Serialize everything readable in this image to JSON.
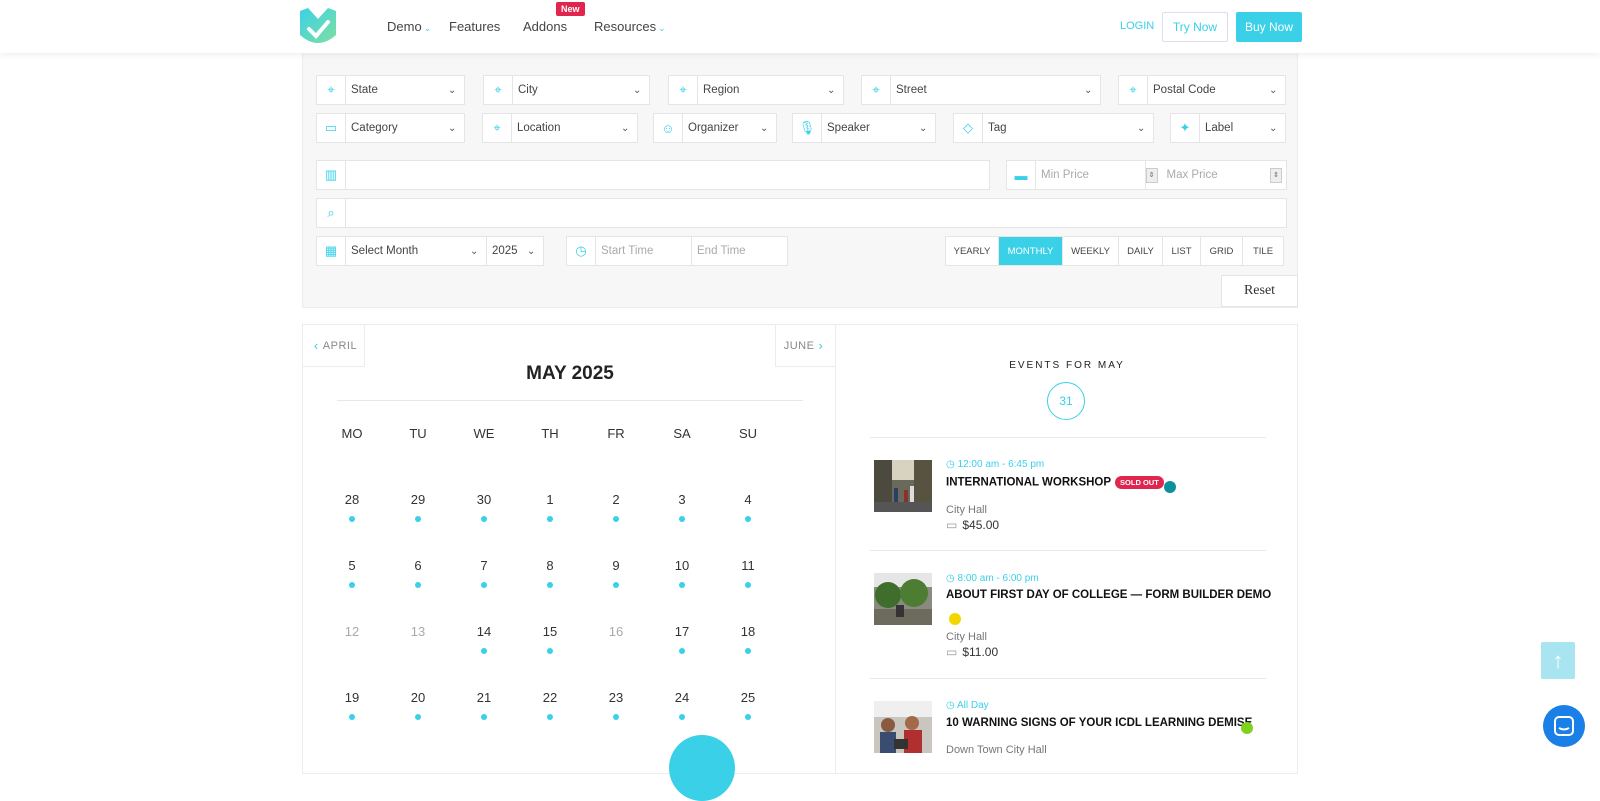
{
  "nav": {
    "logo": "mec-logo",
    "links": [
      {
        "label": "Demo",
        "dropdown": true
      },
      {
        "label": "Features",
        "dropdown": false
      },
      {
        "label": "Addons",
        "dropdown": false
      },
      {
        "label": "Resources",
        "dropdown": true
      }
    ],
    "new_badge": "New",
    "login": "LOGIN",
    "try_now": "Try Now",
    "buy_now": "Buy Now"
  },
  "filters": {
    "state": "State",
    "city": "City",
    "region": "Region",
    "street": "Street",
    "postal_code": "Postal Code",
    "category": "Category",
    "location": "Location",
    "organizer": "Organizer",
    "speaker": "Speaker",
    "tag": "Tag",
    "label": "Label",
    "address_value": "",
    "min_price_placeholder": "Min Price",
    "max_price_placeholder": "Max Price",
    "search_value": "",
    "month": "Select Month",
    "year": "2025",
    "start_time_placeholder": "Start Time",
    "end_time_placeholder": "End Time",
    "views": [
      "YEARLY",
      "MONTHLY",
      "WEEKLY",
      "DAILY",
      "LIST",
      "GRID",
      "TILE"
    ],
    "active_view": "MONTHLY",
    "reset": "Reset"
  },
  "calendar": {
    "prev": "APRIL",
    "next": "JUNE",
    "title": "MAY 2025",
    "weekdays": [
      "MO",
      "TU",
      "WE",
      "TH",
      "FR",
      "SA",
      "SU"
    ],
    "weeks": [
      [
        {
          "d": "28",
          "dot": true
        },
        {
          "d": "29",
          "dot": true
        },
        {
          "d": "30",
          "dot": true
        },
        {
          "d": "1",
          "dot": true
        },
        {
          "d": "2",
          "dot": true
        },
        {
          "d": "3",
          "dot": true
        },
        {
          "d": "4",
          "dot": true
        }
      ],
      [
        {
          "d": "5",
          "dot": true
        },
        {
          "d": "6",
          "dot": true
        },
        {
          "d": "7",
          "dot": true
        },
        {
          "d": "8",
          "dot": true
        },
        {
          "d": "9",
          "dot": true
        },
        {
          "d": "10",
          "dot": true
        },
        {
          "d": "11",
          "dot": true
        }
      ],
      [
        {
          "d": "12",
          "dot": false,
          "muted": true
        },
        {
          "d": "13",
          "dot": false,
          "muted": true
        },
        {
          "d": "14",
          "dot": true
        },
        {
          "d": "15",
          "dot": true
        },
        {
          "d": "16",
          "dot": false,
          "muted": true
        },
        {
          "d": "17",
          "dot": true
        },
        {
          "d": "18",
          "dot": true
        }
      ],
      [
        {
          "d": "19",
          "dot": true
        },
        {
          "d": "20",
          "dot": true
        },
        {
          "d": "21",
          "dot": true
        },
        {
          "d": "22",
          "dot": true
        },
        {
          "d": "23",
          "dot": true
        },
        {
          "d": "24",
          "dot": true
        },
        {
          "d": "25",
          "dot": true
        }
      ]
    ],
    "dot_color": "#3ad0e8"
  },
  "events_panel": {
    "heading": "EVENTS FOR MAY",
    "count": "31",
    "events": [
      {
        "time": "12:00 am - 6:45 pm",
        "title": "INTERNATIONAL WORKSHOP",
        "badge": "SOLD OUT",
        "color": "#0e8f9c",
        "location": "City Hall",
        "price": "$45.00"
      },
      {
        "time": "8:00 am - 6:00 pm",
        "title": "ABOUT FIRST DAY OF COLLEGE — FORM BUILDER DEMO",
        "badge": "",
        "color": "#f2d600",
        "location": "City Hall",
        "price": "$11.00"
      },
      {
        "time": "All Day",
        "title": "10 WARNING SIGNS OF YOUR ICDL LEARNING DEMISE",
        "badge": "",
        "color": "#7fd320",
        "location": "Down Town City Hall",
        "price": ""
      }
    ]
  },
  "colors": {
    "accent": "#3ad0e8",
    "badge_red": "#e0264e"
  }
}
